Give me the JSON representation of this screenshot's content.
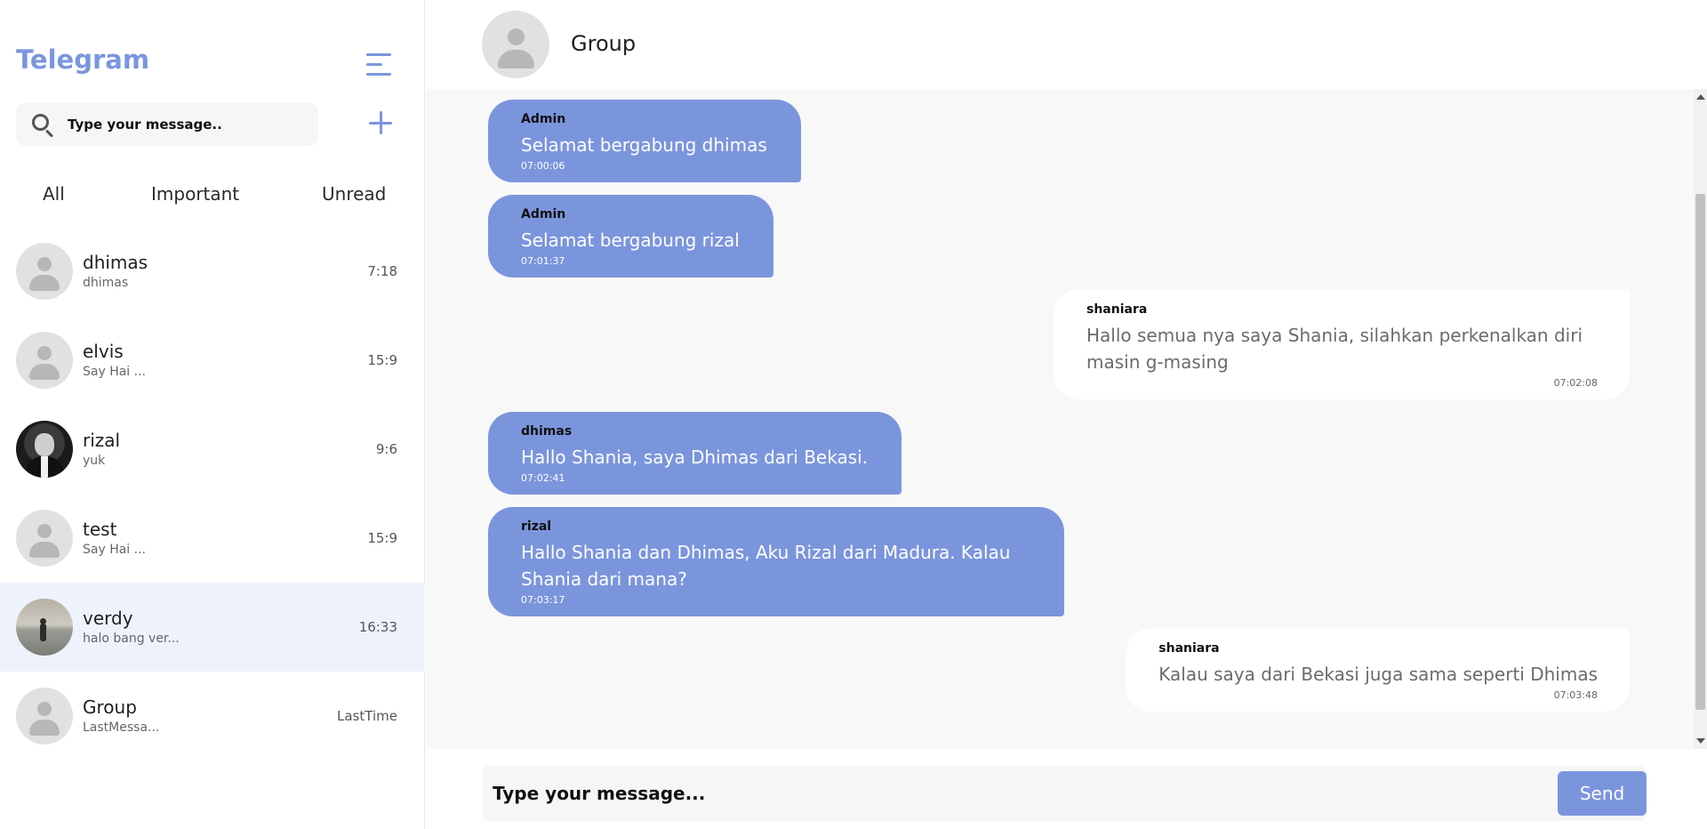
{
  "sidebar": {
    "brand": "Telegram",
    "search_placeholder": "Type your message..",
    "tabs": [
      "All",
      "Important",
      "Unread"
    ],
    "chats": [
      {
        "name": "dhimas",
        "preview": "dhimas",
        "time": "7:18",
        "avatar": "default"
      },
      {
        "name": "elvis",
        "preview": "Say Hai ...",
        "time": "15:9",
        "avatar": "default"
      },
      {
        "name": "rizal",
        "preview": "yuk",
        "time": "9:6",
        "avatar": "photo-rizal"
      },
      {
        "name": "test",
        "preview": "Say Hai ...",
        "time": "15:9",
        "avatar": "default"
      },
      {
        "name": "verdy",
        "preview": "halo bang ver...",
        "time": "16:33",
        "avatar": "photo-verdy",
        "active": true
      },
      {
        "name": "Group",
        "preview": "LastMessa...",
        "time": "LastTime",
        "avatar": "default"
      }
    ]
  },
  "header": {
    "title": "Group"
  },
  "messages": [
    {
      "sender": "Admin",
      "text": "Selamat bergabung dhimas",
      "time": "07:00:06",
      "direction": "in"
    },
    {
      "sender": "Admin",
      "text": "Selamat bergabung rizal",
      "time": "07:01:37",
      "direction": "in"
    },
    {
      "sender": "shaniara",
      "text": "Hallo semua nya saya Shania, silahkan perkenalkan diri masin g-masing",
      "time": "07:02:08",
      "direction": "out"
    },
    {
      "sender": "dhimas",
      "text": "Hallo Shania, saya Dhimas dari Bekasi.",
      "time": "07:02:41",
      "direction": "in"
    },
    {
      "sender": "rizal",
      "text": "Hallo Shania dan Dhimas, Aku Rizal dari Madura. Kalau Shania dari mana?",
      "time": "07:03:17",
      "direction": "in"
    },
    {
      "sender": "shaniara",
      "text": "Kalau saya dari Bekasi juga sama seperti Dhimas",
      "time": "07:03:48",
      "direction": "out"
    }
  ],
  "composer": {
    "placeholder": "Type your message...",
    "send_label": "Send"
  },
  "colors": {
    "accent": "#7b95dd",
    "active_row": "#eef2fc",
    "chat_bg": "#f8f8f8"
  }
}
